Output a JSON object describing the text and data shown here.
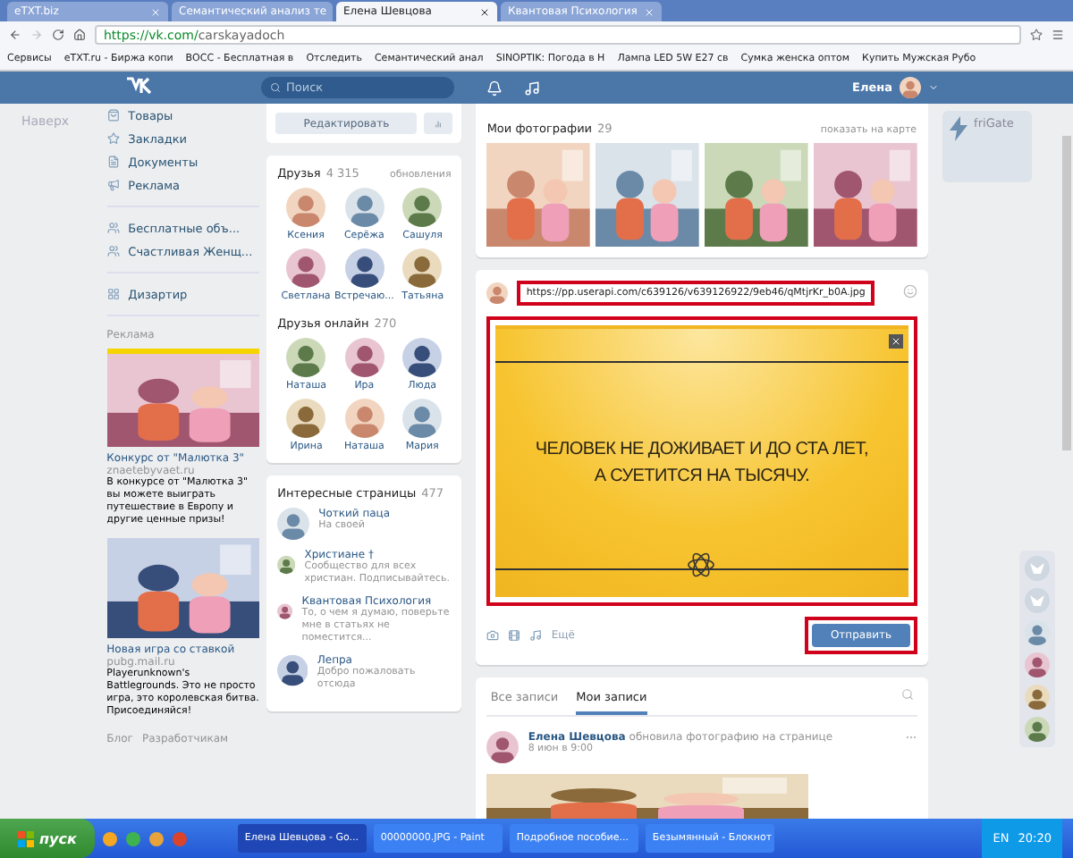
{
  "browser": {
    "tabs": [
      {
        "title": "eTXT.biz",
        "selected": false
      },
      {
        "title": "Семантический анализ те",
        "selected": false
      },
      {
        "title": "Елена Шевцова",
        "selected": true
      },
      {
        "title": "Квантовая Психология",
        "selected": false
      }
    ],
    "address_host": "https://vk.com/",
    "address_path": "carskayadoch",
    "bookmarks": [
      "Сервисы",
      "eTXT.ru - Биржа копи",
      "ВОСС - Бесплатная в",
      "Отследить",
      "Семантический анал",
      "SINOPTIK: Погода в Н",
      "Лампа LED 5W E27 св",
      "Сумка женска оптом",
      "Купить Мужская Рубо"
    ]
  },
  "header": {
    "search_placeholder": "Поиск",
    "user": "Елена"
  },
  "left": {
    "back": "Наверх",
    "menu_groups": [
      [
        {
          "label": "Товары",
          "kind": "bag"
        },
        {
          "label": "Закладки",
          "kind": "star"
        },
        {
          "label": "Документы",
          "kind": "doc"
        },
        {
          "label": "Реклама",
          "kind": "ads"
        }
      ],
      [
        {
          "label": "Бесплатные объ...",
          "kind": "group"
        },
        {
          "label": "Счастливая Женщ...",
          "kind": "group"
        }
      ],
      [
        {
          "label": "Дизартир",
          "kind": "apps"
        }
      ]
    ],
    "ads_title": "Реклама",
    "ads": [
      {
        "title": "Конкурс от \"Малютка 3\"",
        "domain": "znaetebyvaet.ru",
        "text": "В конкурсе от \"Малютка 3\" вы можете выиграть путешествие в Европу и другие ценные призы!"
      },
      {
        "title": "Новая игра со ставкой",
        "domain": "pubg.mail.ru",
        "text": "Playerunknown's Battlegrounds. Это не просто игра, это королевская битва. Присоединяйся!"
      }
    ],
    "footer_links": [
      "Блог",
      "Разработчикам"
    ]
  },
  "middle": {
    "edit_button": "Редактировать",
    "friends": {
      "title": "Друзья",
      "count": "4 315",
      "link": "обновления",
      "people": [
        "Ксения",
        "Серёжа",
        "Сашуля",
        "Светлана",
        "Встречаю...",
        "Татьяна"
      ]
    },
    "online": {
      "title": "Друзья онлайн",
      "count": "270",
      "people": [
        "Наташа",
        "Ира",
        "Люда",
        "Ирина",
        "Наташа",
        "Мария"
      ]
    },
    "pages": {
      "title": "Интересные страницы",
      "count": "477",
      "items": [
        {
          "name": "Чоткий паца",
          "desc": "На своей"
        },
        {
          "name": "Христиане †",
          "desc": "Сообщество для всех христиан. Подписывайтесь."
        },
        {
          "name": "Квантовая Психология",
          "desc": "То, о чем я думаю, поверьте мне в статьях не поместится..."
        },
        {
          "name": "Лепра",
          "desc": "Добро пожаловать отсюда"
        }
      ]
    }
  },
  "main": {
    "photos": {
      "title": "Мои фотографии",
      "count": "29",
      "link": "показать на карте"
    },
    "composer": {
      "text": "https://pp.userapi.com/c639126/v639126922/9eb46/qMtjrKr_b0A.jpg",
      "text_highlighted": true,
      "attachment": {
        "lines": [
          "ЧЕЛОВЕК НЕ ДОЖИВАЕТ И ДО СТА ЛЕТ,",
          "А СУЕТИТСЯ НА ТЫСЯЧУ."
        ],
        "highlighted": true
      },
      "more": "Ещё",
      "submit": "Отправить",
      "submit_highlighted": true
    },
    "wall_tabs": [
      {
        "label": "Все записи",
        "selected": false
      },
      {
        "label": "Мои записи",
        "selected": true
      }
    ],
    "post": {
      "author": "Елена Шевцова",
      "action": "обновила фотографию на странице",
      "date": "8 июн в 9:00"
    }
  },
  "right": {
    "widget": "friGate"
  },
  "taskbar": {
    "start": "пуск",
    "windows": [
      {
        "title": "Елена Шевцова - Go...",
        "selected": true
      },
      {
        "title": "00000000.JPG - Paint",
        "selected": false
      },
      {
        "title": "Подробное пособие...",
        "selected": false
      },
      {
        "title": "Безымянный - Блокнот",
        "selected": false
      }
    ],
    "lang": "EN",
    "time": "20:20"
  }
}
